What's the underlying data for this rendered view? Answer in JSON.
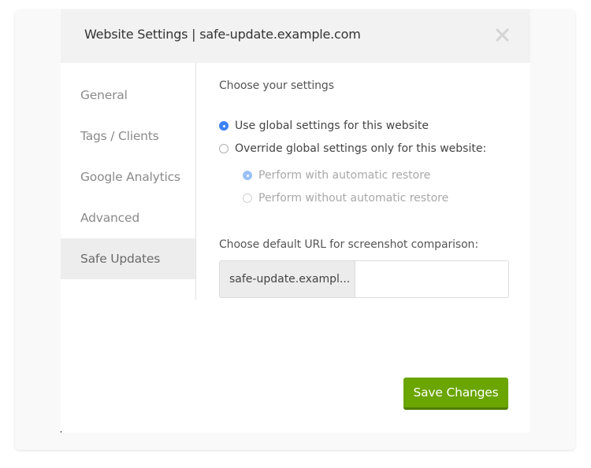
{
  "modal": {
    "title": "Website Settings | safe-update.example.com",
    "close_icon": "close-x-icon"
  },
  "sidebar": {
    "items": [
      {
        "label": "General",
        "active": false
      },
      {
        "label": "Tags / Clients",
        "active": false
      },
      {
        "label": "Google Analytics",
        "active": false
      },
      {
        "label": "Advanced",
        "active": false
      },
      {
        "label": "Safe Updates",
        "active": true
      }
    ]
  },
  "settings": {
    "heading": "Choose your settings",
    "options": [
      {
        "label": "Use global settings for this website",
        "checked": true
      },
      {
        "label": "Override global settings only for this website:",
        "checked": false
      }
    ],
    "sub_options": [
      {
        "label": "Perform with automatic restore",
        "checked": true,
        "disabled": true
      },
      {
        "label": "Perform without automatic restore",
        "checked": false,
        "disabled": true
      }
    ]
  },
  "url": {
    "heading": "Choose default URL for screenshot comparison:",
    "prefix": "safe-update.exampl...",
    "value": "",
    "placeholder": ""
  },
  "actions": {
    "save_label": "Save Changes"
  },
  "colors": {
    "accent_blue": "#3b82f6",
    "save_green": "#6aa500"
  }
}
